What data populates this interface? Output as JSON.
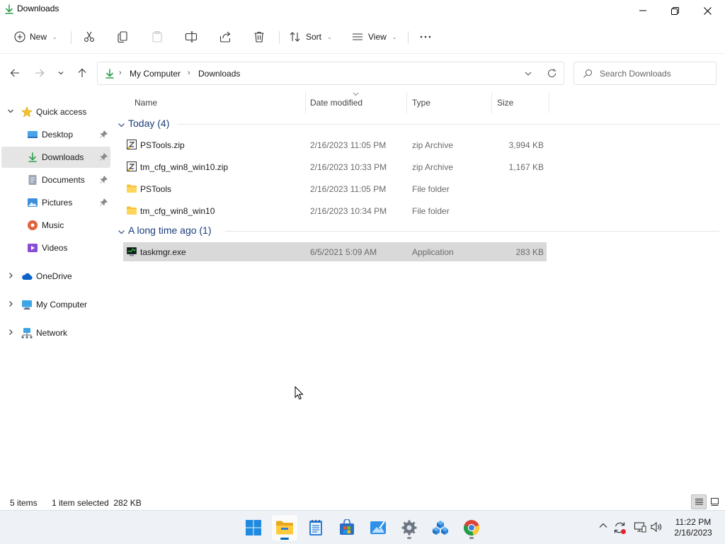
{
  "window": {
    "title": "Downloads"
  },
  "toolbar": {
    "new_label": "New",
    "sort_label": "Sort",
    "view_label": "View"
  },
  "address": {
    "crumbs": [
      "My Computer",
      "Downloads"
    ]
  },
  "search": {
    "placeholder": "Search Downloads"
  },
  "sidebar": {
    "items": [
      {
        "label": "Quick access"
      },
      {
        "label": "Desktop"
      },
      {
        "label": "Downloads"
      },
      {
        "label": "Documents"
      },
      {
        "label": "Pictures"
      },
      {
        "label": "Music"
      },
      {
        "label": "Videos"
      },
      {
        "label": "OneDrive"
      },
      {
        "label": "My Computer"
      },
      {
        "label": "Network"
      }
    ]
  },
  "columns": {
    "name": "Name",
    "date": "Date modified",
    "type": "Type",
    "size": "Size"
  },
  "groups": [
    {
      "title": "Today (4)",
      "files": [
        {
          "name": "PSTools.zip",
          "date": "2/16/2023 11:05 PM",
          "type": "zip Archive",
          "size": "3,994 KB",
          "icon": "zip-icon"
        },
        {
          "name": "tm_cfg_win8_win10.zip",
          "date": "2/16/2023 10:33 PM",
          "type": "zip Archive",
          "size": "1,167 KB",
          "icon": "zip-icon"
        },
        {
          "name": "PSTools",
          "date": "2/16/2023 11:05 PM",
          "type": "File folder",
          "size": "",
          "icon": "folder-icon"
        },
        {
          "name": "tm_cfg_win8_win10",
          "date": "2/16/2023 10:34 PM",
          "type": "File folder",
          "size": "",
          "icon": "folder-icon"
        }
      ]
    },
    {
      "title": "A long time ago (1)",
      "files": [
        {
          "name": "taskmgr.exe",
          "date": "6/5/2021 5:09 AM",
          "type": "Application",
          "size": "283 KB",
          "icon": "taskmgr-icon"
        }
      ]
    }
  ],
  "status": {
    "count": "5 items",
    "selection": "1 item selected  282 KB"
  },
  "clock": {
    "time": "11:22 PM",
    "date": "2/16/2023"
  },
  "colors": {
    "accent": "#0067c0",
    "folder": "#f3c13a",
    "download_green": "#2e9e4e",
    "group_title": "#1b3d7a"
  }
}
